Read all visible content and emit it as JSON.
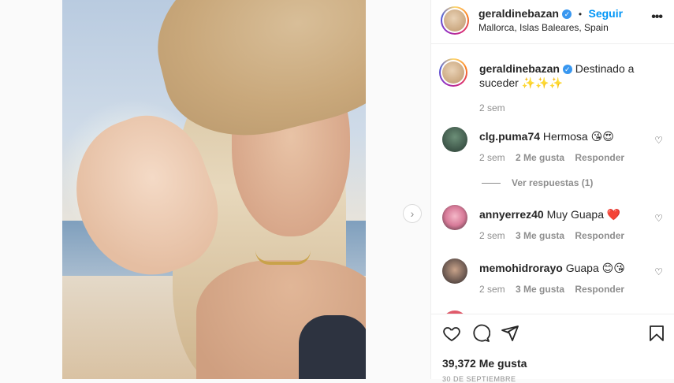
{
  "post": {
    "username": "geraldinebazan",
    "follow_label": "Seguir",
    "dot": "•",
    "location": "Mallorca, Islas Baleares, Spain",
    "more_label": "•••",
    "next_label": "›"
  },
  "caption": {
    "username": "geraldinebazan",
    "text": "Destinado a suceder ✨✨✨",
    "time": "2 sem"
  },
  "comments": [
    {
      "username": "clg.puma74",
      "text": "Hermosa 😘😍",
      "time": "2 sem",
      "likes": "2 Me gusta",
      "reply": "Responder"
    },
    {
      "username": "annyerrez40",
      "text": "Muy Guapa ❤️",
      "time": "2 sem",
      "likes": "3 Me gusta",
      "reply": "Responder"
    },
    {
      "username": "memohidrorayo",
      "text": "Guapa 😊😘",
      "time": "2 sem",
      "likes": "3 Me gusta",
      "reply": "Responder"
    }
  ],
  "view_replies": "Ver respuestas (1)",
  "likes_count": "39,372 Me gusta",
  "date": "30 DE SEPTIEMBRE",
  "icons": [
    "heart-icon",
    "comment-icon",
    "share-icon",
    "bookmark-icon",
    "verified-icon",
    "more-icon",
    "chevron-right-icon"
  ]
}
